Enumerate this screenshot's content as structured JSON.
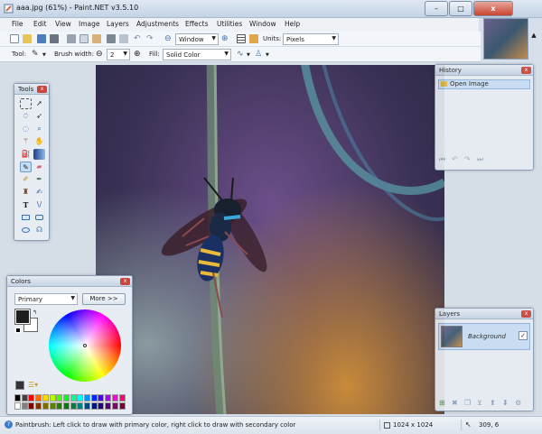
{
  "window": {
    "title": "aaa.jpg (61%) - Paint.NET v3.5.10",
    "buttons": {
      "minimize": "–",
      "maximize": "□",
      "close": "x"
    }
  },
  "menubar": [
    "File",
    "Edit",
    "View",
    "Image",
    "Layers",
    "Adjustments",
    "Effects",
    "Utilities",
    "Window",
    "Help"
  ],
  "toolbar1": {
    "zoom_value": "Window",
    "units_label": "Units:",
    "units_value": "Pixels"
  },
  "toolbar2": {
    "tool_label": "Tool:",
    "brush_width_label": "Brush width:",
    "brush_width_value": "2",
    "fill_label": "Fill:",
    "fill_value": "Solid Color"
  },
  "tools_panel": {
    "title": "Tools",
    "icons": [
      "rectangle-select-icon",
      "move-selection-icon",
      "lasso-select-icon",
      "move-selected-icon",
      "ellipse-select-icon",
      "zoom-icon",
      "magic-wand-icon",
      "pan-icon",
      "paint-bucket-icon",
      "gradient-icon",
      "paintbrush-icon",
      "eraser-icon",
      "pencil-icon",
      "color-picker-icon",
      "clone-stamp-icon",
      "recolor-icon",
      "text-icon",
      "line-curve-icon",
      "rectangle-icon",
      "rounded-rectangle-icon",
      "ellipse-icon",
      "freeform-shape-icon"
    ]
  },
  "history_panel": {
    "title": "History",
    "items": [
      "Open Image"
    ]
  },
  "layers_panel": {
    "title": "Layers",
    "layers": [
      {
        "name": "Background",
        "visible": "✓"
      }
    ]
  },
  "colors_panel": {
    "title": "Colors",
    "mode": "Primary",
    "more_button": "More >>",
    "palette": [
      "#000000",
      "#404040",
      "#ff0000",
      "#ff6a00",
      "#ffd800",
      "#b6ff00",
      "#4cff00",
      "#00ff21",
      "#00ff90",
      "#00ffff",
      "#0094ff",
      "#0026ff",
      "#4800ff",
      "#b200ff",
      "#ff00dc",
      "#ff006e",
      "#ffffff",
      "#808080",
      "#7f0000",
      "#7f3300",
      "#7f6a00",
      "#5b7f00",
      "#267f00",
      "#007f0e",
      "#007f46",
      "#007f7f",
      "#004a7f",
      "#00137f",
      "#21007f",
      "#57007f",
      "#7f006e",
      "#7f0037"
    ],
    "primary_color": "#1e1e1e",
    "secondary_color": "#ffffff"
  },
  "statusbar": {
    "hint": "Paintbrush: Left click to draw with primary color, right click to draw with secondary color",
    "image_size": "1024 x 1024",
    "cursor_pos": "309, 6"
  }
}
